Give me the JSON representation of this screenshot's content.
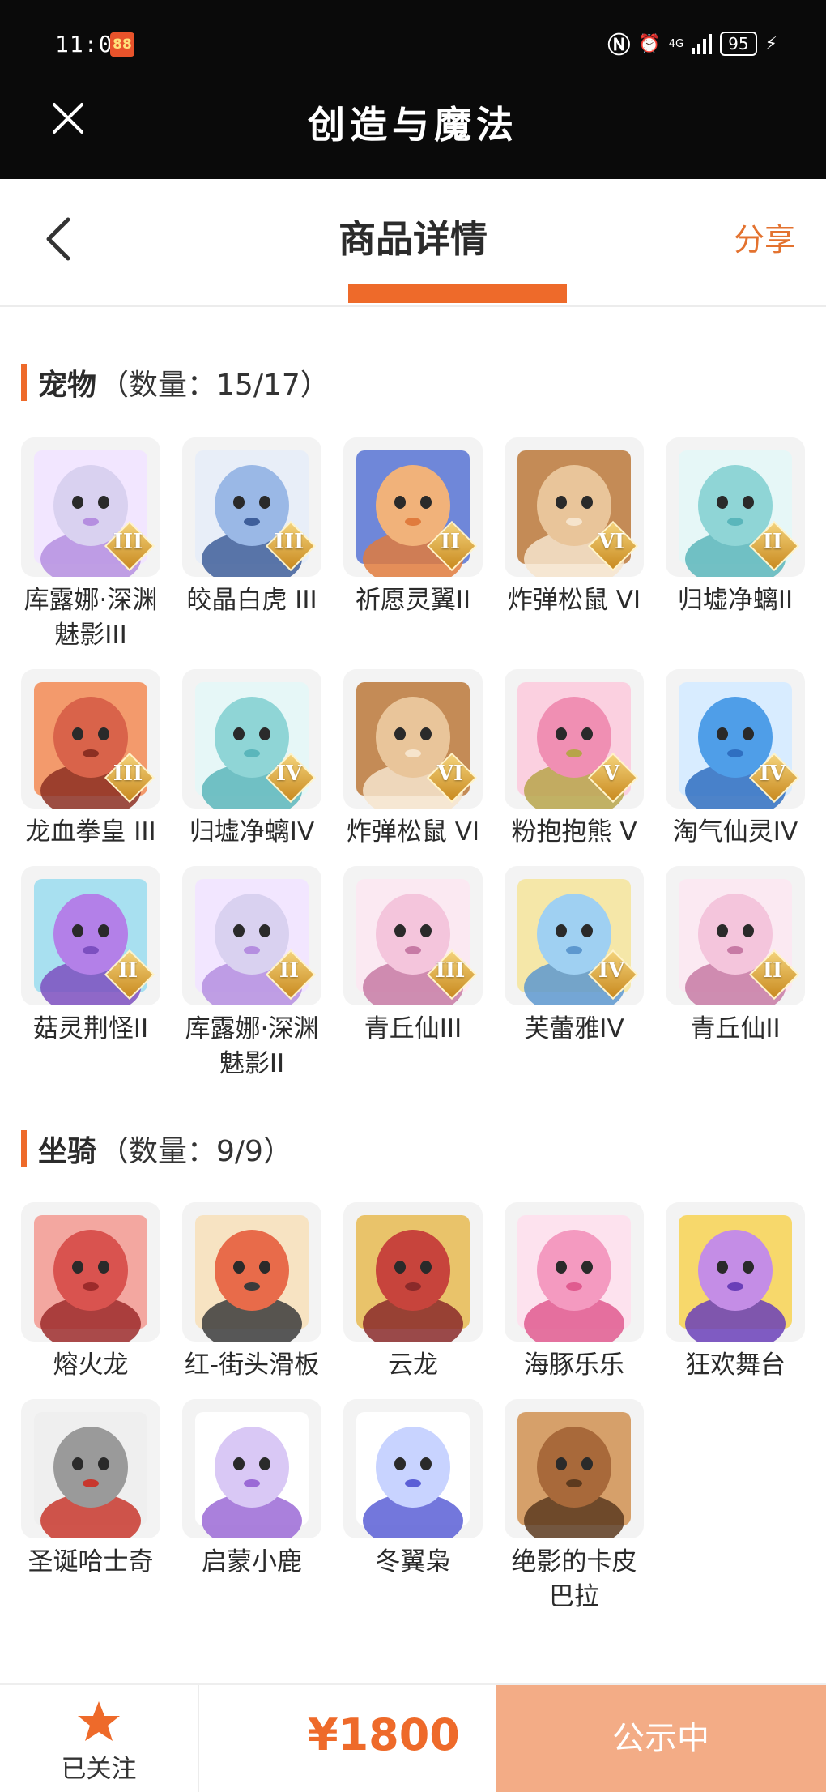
{
  "status_bar": {
    "time": "11:01",
    "app_badge": "88",
    "network": "4G",
    "battery": "95"
  },
  "app": {
    "title": "创造与魔法"
  },
  "header": {
    "title": "商品详情",
    "share_label": "分享"
  },
  "pets_section": {
    "name": "宠物",
    "count": "（数量：15/17）",
    "items": [
      {
        "name": "库露娜·深渊魅影III",
        "tier": "III",
        "palette": [
          "#d9d1f0",
          "#f2e6ff",
          "#b58ee0"
        ]
      },
      {
        "name": "皎晶白虎 III",
        "tier": "III",
        "palette": [
          "#9ab8e6",
          "#e8eef8",
          "#3e5e9a"
        ]
      },
      {
        "name": "祈愿灵翼II",
        "tier": "II",
        "palette": [
          "#f1b27a",
          "#6f87d9",
          "#e07b3d"
        ]
      },
      {
        "name": "炸弹松鼠 VI",
        "tier": "VI",
        "palette": [
          "#e9c59a",
          "#c48b56",
          "#f6e4cc"
        ]
      },
      {
        "name": "归墟净螭II",
        "tier": "II",
        "palette": [
          "#8fd5d6",
          "#e6f7f7",
          "#5ab6bb"
        ]
      },
      {
        "name": "龙血拳皇 III",
        "tier": "III",
        "palette": [
          "#d9634a",
          "#f39a6c",
          "#8c2f22"
        ]
      },
      {
        "name": "归墟净螭IV",
        "tier": "IV",
        "palette": [
          "#8fd5d6",
          "#e6f7f7",
          "#5ab6bb"
        ]
      },
      {
        "name": "炸弹松鼠 VI",
        "tier": "VI",
        "palette": [
          "#e9c59a",
          "#c48b56",
          "#f6e4cc"
        ]
      },
      {
        "name": "粉抱抱熊 V",
        "tier": "V",
        "palette": [
          "#f08fb3",
          "#fbd0e0",
          "#b7a44a"
        ]
      },
      {
        "name": "淘气仙灵IV",
        "tier": "IV",
        "palette": [
          "#4f9ee8",
          "#d8ecff",
          "#2f6fc1"
        ]
      },
      {
        "name": "菇灵荆怪II",
        "tier": "II",
        "palette": [
          "#b380e8",
          "#a8e0f0",
          "#7c4fc0"
        ]
      },
      {
        "name": "库露娜·深渊魅影II",
        "tier": "II",
        "palette": [
          "#d9d1f0",
          "#f2e6ff",
          "#b58ee0"
        ]
      },
      {
        "name": "青丘仙III",
        "tier": "III",
        "palette": [
          "#f4c5dc",
          "#fbe9f2",
          "#c77aa5"
        ]
      },
      {
        "name": "芙蕾雅IV",
        "tier": "IV",
        "palette": [
          "#9fd0f2",
          "#f5e7a8",
          "#5d98cf"
        ]
      },
      {
        "name": "青丘仙II",
        "tier": "II",
        "palette": [
          "#f4c5dc",
          "#fbe9f2",
          "#c77aa5"
        ]
      }
    ]
  },
  "mounts_section": {
    "name": "坐骑",
    "count": "（数量：9/9）",
    "items": [
      {
        "name": "熔火龙",
        "tier": "",
        "palette": [
          "#d9534f",
          "#f3a7a0",
          "#9c2b2b"
        ]
      },
      {
        "name": "红-街头滑板",
        "tier": "",
        "palette": [
          "#e86b4a",
          "#f7e3c2",
          "#3b3b3b"
        ]
      },
      {
        "name": "云龙",
        "tier": "",
        "palette": [
          "#c7443c",
          "#e9c36a",
          "#8a2a2a"
        ]
      },
      {
        "name": "海豚乐乐",
        "tier": "",
        "palette": [
          "#f49ac0",
          "#fde2ee",
          "#e05b8f"
        ]
      },
      {
        "name": "狂欢舞台",
        "tier": "",
        "palette": [
          "#c48de6",
          "#f7d86b",
          "#6a3fb8"
        ]
      },
      {
        "name": "圣诞哈士奇",
        "tier": "",
        "palette": [
          "#9a9a9a",
          "#efefef",
          "#c8372d"
        ]
      },
      {
        "name": "启蒙小鹿",
        "tier": "",
        "palette": [
          "#d9c8f5",
          "#ffffff",
          "#9b6ad6"
        ]
      },
      {
        "name": "冬翼枭",
        "tier": "",
        "palette": [
          "#c8d3ff",
          "#ffffff",
          "#5b5fd6"
        ]
      },
      {
        "name": "绝影的卡皮巴拉",
        "tier": "",
        "palette": [
          "#a8693a",
          "#d6a06a",
          "#5c3a1e"
        ]
      }
    ]
  },
  "bottom_bar": {
    "follow_label": "已关注",
    "price": "¥1800",
    "status_button": "公示中"
  },
  "colors": {
    "accent": "#ee6a2a",
    "share": "#e3722f",
    "status_button": "#f3ac86"
  }
}
